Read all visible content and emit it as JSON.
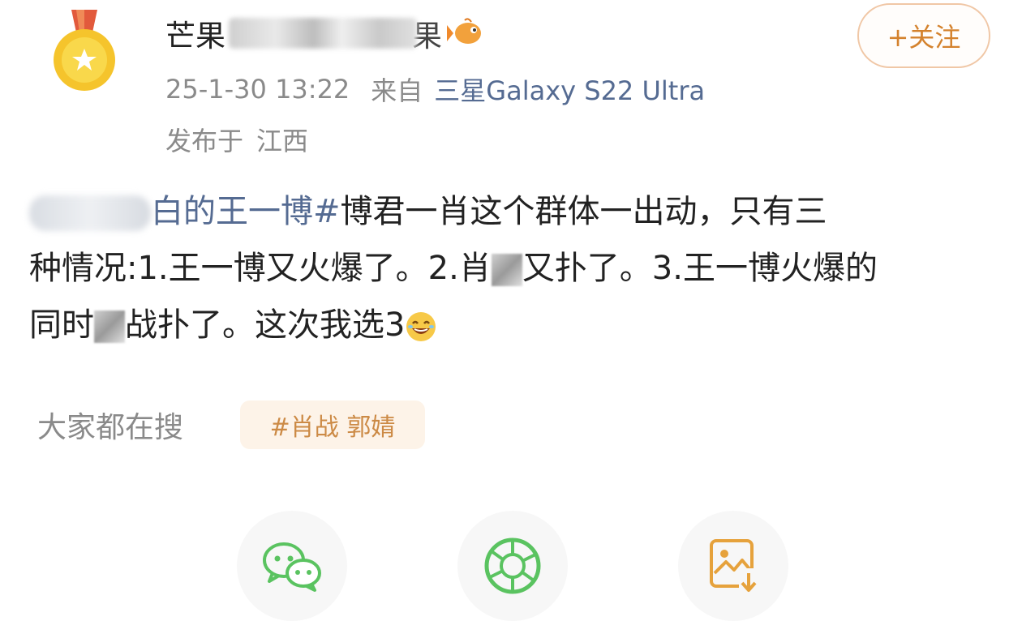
{
  "post": {
    "author": {
      "name_prefix": "芒果",
      "name_suffix": "果"
    },
    "follow_label": "+关注",
    "date": "25-1-30 13:22",
    "from_label": "来自",
    "device": "三星Galaxy S22 Ultra",
    "location_label": "发布于",
    "location": "江西",
    "content": {
      "topic_visible": "白的王一博#",
      "text_line1": "博君一肖这个群体一出动，只有三",
      "text_line2a": "种情况:1.王一博又火爆了。2.肖",
      "text_line2b": "又扑了。3.王一博火爆的",
      "text_line3a": "同时",
      "text_line3b": "战扑了。这次我选3"
    }
  },
  "search": {
    "label": "大家都在搜",
    "chip": "#肖战 郭婧"
  },
  "share": {
    "wechat_icon": "wechat-icon",
    "moments_icon": "moments-icon",
    "save_image_icon": "save-image-icon"
  },
  "colors": {
    "accent_orange": "#d4822d",
    "link_blue": "#556b92",
    "meta_gray": "#8a8a8a",
    "wechat_green": "#5ac360"
  }
}
